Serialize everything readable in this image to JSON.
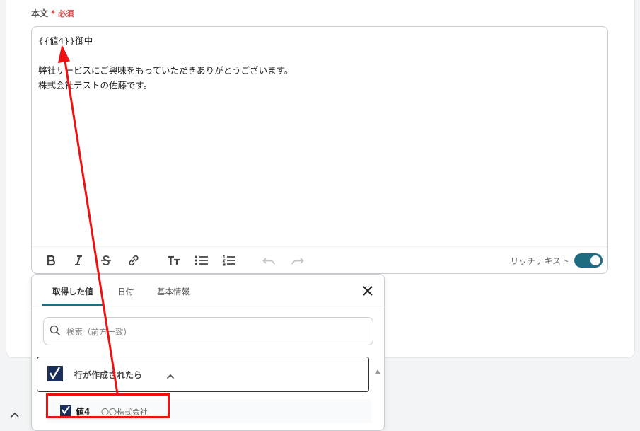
{
  "field": {
    "label": "本文",
    "required_star": "*",
    "required_text": "必須"
  },
  "editor": {
    "lines": [
      "{{値4}}御中",
      "",
      "弊社サービスにご興味をもっていただきありがとうございます。",
      "株式会社テストの佐藤です。"
    ],
    "toolbar": {
      "icons": [
        "bold-icon",
        "italic-icon",
        "strikethrough-icon",
        "link-icon",
        "text-size-icon",
        "bullet-list-icon",
        "numbered-list-icon",
        "undo-icon",
        "redo-icon"
      ],
      "rich_text_label": "リッチテキスト",
      "rich_text_enabled": true
    }
  },
  "popup": {
    "tabs": [
      {
        "label": "取得した値",
        "active": true
      },
      {
        "label": "日付",
        "active": false
      },
      {
        "label": "基本情報",
        "active": false
      }
    ],
    "search_placeholder": "検索（前方一致)",
    "group": {
      "label": "行が作成されたら",
      "expanded": true
    },
    "items": [
      {
        "label": "値4",
        "value": "〇〇株式会社"
      }
    ]
  },
  "colors": {
    "accent": "#1f6c82",
    "required": "#e04848",
    "annotation": "#ee1111",
    "logo_navy": "#1c2e5a"
  }
}
